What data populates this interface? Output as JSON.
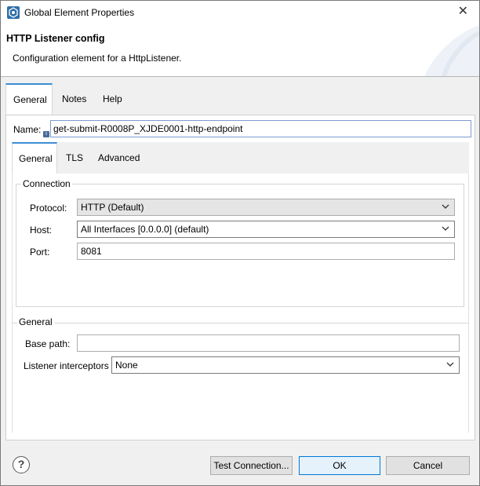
{
  "window": {
    "title": "Global Element Properties",
    "close_glyph": "✕"
  },
  "header": {
    "title": "HTTP Listener config",
    "description": "Configuration element for a HttpListener."
  },
  "outer_tabs": [
    {
      "label": "General",
      "active": true
    },
    {
      "label": "Notes",
      "active": false
    },
    {
      "label": "Help",
      "active": false
    }
  ],
  "name": {
    "label": "Name:",
    "value": "get-submit-R0008P_XJDE0001-http-endpoint",
    "info_icon": "i"
  },
  "inner_tabs": [
    {
      "label": "General",
      "active": true
    },
    {
      "label": "TLS",
      "active": false
    },
    {
      "label": "Advanced",
      "active": false
    }
  ],
  "connection": {
    "legend": "Connection",
    "protocol_label": "Protocol:",
    "protocol_value": "HTTP (Default)",
    "host_label": "Host:",
    "host_value": "All Interfaces [0.0.0.0] (default)",
    "port_label": "Port:",
    "port_value": "8081"
  },
  "general": {
    "legend": "General",
    "base_path_label": "Base path:",
    "base_path_value": "",
    "interceptors_label": "Listener interceptors",
    "interceptors_value": "None"
  },
  "buttons": {
    "help": "?",
    "test_connection": "Test Connection...",
    "ok": "OK",
    "cancel": "Cancel"
  },
  "colors": {
    "accent": "#3c8dd4",
    "default_button_border": "#0078d7"
  }
}
